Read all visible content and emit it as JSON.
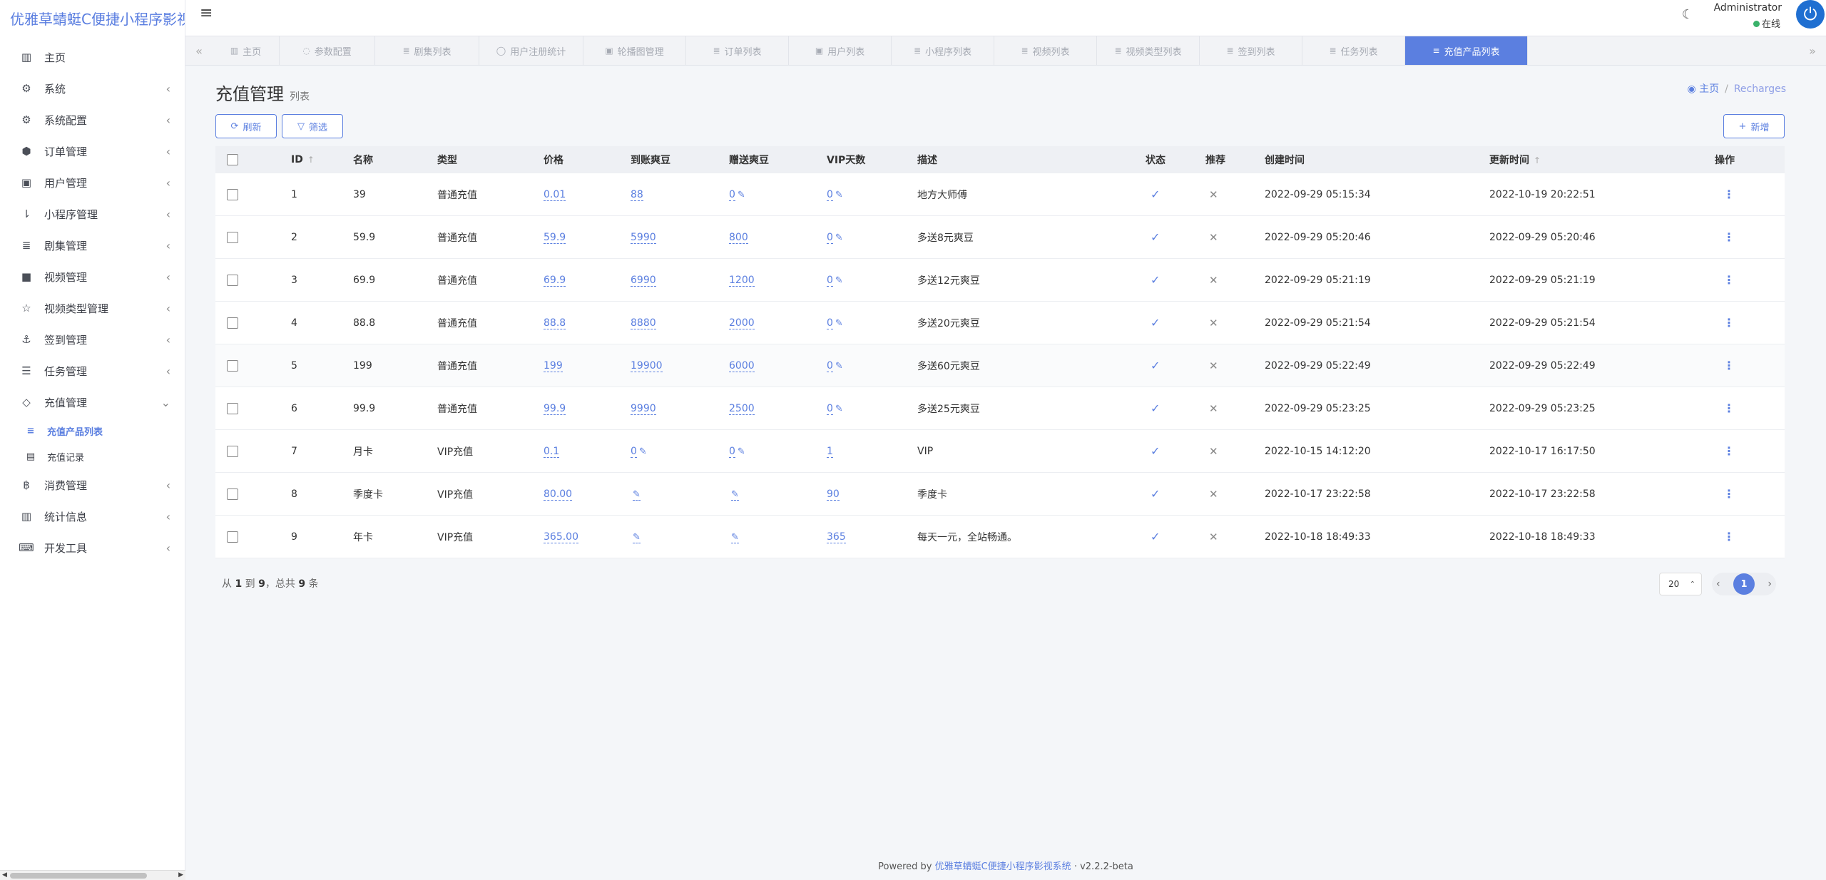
{
  "app": {
    "title": "优雅草蜻蜓C便捷小程序影视系统"
  },
  "sidebar": {
    "items": [
      {
        "label": "主页",
        "icon": "dashboard-icon",
        "glyph": "▥",
        "expandable": false
      },
      {
        "label": "系统",
        "icon": "gear-icon",
        "glyph": "⚙",
        "expandable": true
      },
      {
        "label": "系统配置",
        "icon": "gears-icon",
        "glyph": "⚙",
        "expandable": true
      },
      {
        "label": "订单管理",
        "icon": "hexagon-icon",
        "glyph": "⬢",
        "expandable": true
      },
      {
        "label": "用户管理",
        "icon": "user-book-icon",
        "glyph": "▣",
        "expandable": true
      },
      {
        "label": "小程序管理",
        "icon": "sort-amount-icon",
        "glyph": "⇂",
        "expandable": true
      },
      {
        "label": "剧集管理",
        "icon": "list-icon",
        "glyph": "≣",
        "expandable": true
      },
      {
        "label": "视频管理",
        "icon": "video-camera-icon",
        "glyph": "■",
        "expandable": true
      },
      {
        "label": "视频类型管理",
        "icon": "star-half-icon",
        "glyph": "☆",
        "expandable": true
      },
      {
        "label": "签到管理",
        "icon": "anchor-icon",
        "glyph": "⚓",
        "expandable": true
      },
      {
        "label": "任务管理",
        "icon": "tasks-icon",
        "glyph": "☰",
        "expandable": true
      },
      {
        "label": "充值管理",
        "icon": "diamond-icon",
        "glyph": "◇",
        "expandable": true,
        "expanded": true
      }
    ],
    "subitems": [
      {
        "label": "充值产品列表",
        "icon": "list-icon",
        "glyph": "≡",
        "active": true
      },
      {
        "label": "充值记录",
        "icon": "list-alt-icon",
        "glyph": "▤",
        "active": false
      }
    ],
    "items_after": [
      {
        "label": "消费管理",
        "icon": "bitcoin-icon",
        "glyph": "฿",
        "expandable": true
      },
      {
        "label": "统计信息",
        "icon": "bar-chart-icon",
        "glyph": "▥",
        "expandable": true
      },
      {
        "label": "开发工具",
        "icon": "keyboard-icon",
        "glyph": "⌨",
        "expandable": true
      }
    ]
  },
  "topbar": {
    "user_name": "Administrator",
    "status": "在线"
  },
  "tabs": [
    {
      "label": "主页",
      "glyph": "▥",
      "width": 94
    },
    {
      "label": "参数配置",
      "glyph": "◌",
      "width": 134
    },
    {
      "label": "剧集列表",
      "glyph": "≣",
      "width": 146
    },
    {
      "label": "用户注册统计",
      "glyph": "◯",
      "width": 146
    },
    {
      "label": "轮播图管理",
      "glyph": "▣",
      "width": 144
    },
    {
      "label": "订单列表",
      "glyph": "≣",
      "width": 144
    },
    {
      "label": "用户列表",
      "glyph": "▣",
      "width": 144
    },
    {
      "label": "小程序列表",
      "glyph": "≣",
      "width": 144
    },
    {
      "label": "视频列表",
      "glyph": "≣",
      "width": 144
    },
    {
      "label": "视频类型列表",
      "glyph": "≣",
      "width": 144
    },
    {
      "label": "签到列表",
      "glyph": "≣",
      "width": 144
    },
    {
      "label": "任务列表",
      "glyph": "≣",
      "width": 144
    },
    {
      "label": "充值产品列表",
      "glyph": "≡",
      "width": 172,
      "active": true
    }
  ],
  "page": {
    "title": "充值管理",
    "subtitle": "列表",
    "breadcrumb": {
      "home": "主页",
      "current": "Recharges"
    },
    "buttons": {
      "refresh": "刷新",
      "filter": "筛选",
      "add": "新增"
    }
  },
  "table": {
    "headers": {
      "id": "ID",
      "name": "名称",
      "type": "类型",
      "price": "价格",
      "arrive": "到账爽豆",
      "gift": "赠送爽豆",
      "vip_days": "VIP天数",
      "desc": "描述",
      "status": "状态",
      "recommend": "推荐",
      "created": "创建时间",
      "updated": "更新时间",
      "actions": "操作"
    },
    "rows": [
      {
        "id": "1",
        "name": "39",
        "type": "普通充值",
        "price": "0.01",
        "arrive": "88",
        "gift": "0",
        "vip_days": "0",
        "desc": "地方大师傅",
        "status": true,
        "recommend": false,
        "created": "2022-09-29 05:15:34",
        "updated": "2022-10-19 20:22:51"
      },
      {
        "id": "2",
        "name": "59.9",
        "type": "普通充值",
        "price": "59.9",
        "arrive": "5990",
        "gift": "800",
        "vip_days": "0",
        "desc": "多送8元爽豆",
        "status": true,
        "recommend": false,
        "created": "2022-09-29 05:20:46",
        "updated": "2022-09-29 05:20:46"
      },
      {
        "id": "3",
        "name": "69.9",
        "type": "普通充值",
        "price": "69.9",
        "arrive": "6990",
        "gift": "1200",
        "vip_days": "0",
        "desc": "多送12元爽豆",
        "status": true,
        "recommend": false,
        "created": "2022-09-29 05:21:19",
        "updated": "2022-09-29 05:21:19"
      },
      {
        "id": "4",
        "name": "88.8",
        "type": "普通充值",
        "price": "88.8",
        "arrive": "8880",
        "gift": "2000",
        "vip_days": "0",
        "desc": "多送20元爽豆",
        "status": true,
        "recommend": false,
        "created": "2022-09-29 05:21:54",
        "updated": "2022-09-29 05:21:54"
      },
      {
        "id": "5",
        "name": "199",
        "type": "普通充值",
        "price": "199",
        "arrive": "19900",
        "gift": "6000",
        "vip_days": "0",
        "desc": "多送60元爽豆",
        "status": true,
        "recommend": false,
        "created": "2022-09-29 05:22:49",
        "updated": "2022-09-29 05:22:49"
      },
      {
        "id": "6",
        "name": "99.9",
        "type": "普通充值",
        "price": "99.9",
        "arrive": "9990",
        "gift": "2500",
        "vip_days": "0",
        "desc": "多送25元爽豆",
        "status": true,
        "recommend": false,
        "created": "2022-09-29 05:23:25",
        "updated": "2022-09-29 05:23:25"
      },
      {
        "id": "7",
        "name": "月卡",
        "type": "VIP充值",
        "price": "0.1",
        "arrive": "0",
        "gift": "0",
        "vip_days": "1",
        "desc": "VIP",
        "status": true,
        "recommend": false,
        "created": "2022-10-15 14:12:20",
        "updated": "2022-10-17 16:17:50"
      },
      {
        "id": "8",
        "name": "季度卡",
        "type": "VIP充值",
        "price": "80.00",
        "arrive": "",
        "gift": "",
        "vip_days": "90",
        "desc": "季度卡",
        "status": true,
        "recommend": false,
        "created": "2022-10-17 23:22:58",
        "updated": "2022-10-17 23:22:58"
      },
      {
        "id": "9",
        "name": "年卡",
        "type": "VIP充值",
        "price": "365.00",
        "arrive": "",
        "gift": "",
        "vip_days": "365",
        "desc": "每天一元，全站畅通。",
        "status": true,
        "recommend": false,
        "created": "2022-10-18 18:49:33",
        "updated": "2022-10-18 18:49:33"
      }
    ]
  },
  "pagination": {
    "summary_prefix": "从",
    "from": "1",
    "to_label": "到",
    "to": "9",
    "total_label": "，总共",
    "total": "9",
    "unit": "条",
    "page_size": "20",
    "current_page": "1"
  },
  "footer": {
    "powered": "Powered by",
    "link": "优雅草蜻蜓C便捷小程序影视系统",
    "version": "· v2.2.2-beta"
  },
  "colors": {
    "accent": "#5b7fe0",
    "brand": "#5a7ee0",
    "online": "#3ab26a",
    "avatar": "#1f6fd1"
  }
}
